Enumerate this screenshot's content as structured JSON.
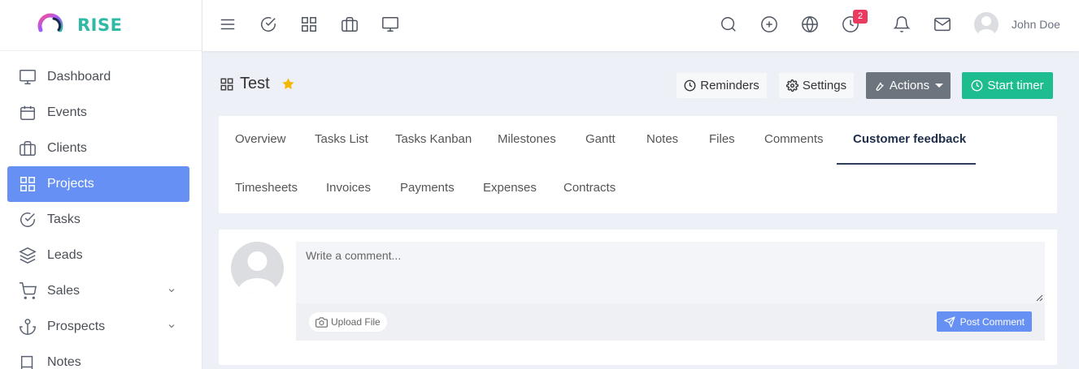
{
  "brand": {
    "name": "RISE",
    "logo": "rise-logo"
  },
  "sidebar": {
    "items": [
      {
        "label": "Dashboard",
        "icon": "monitor-icon"
      },
      {
        "label": "Events",
        "icon": "calendar-icon"
      },
      {
        "label": "Clients",
        "icon": "briefcase-icon"
      },
      {
        "label": "Projects",
        "icon": "grid-icon",
        "active": true
      },
      {
        "label": "Tasks",
        "icon": "check-circle-icon"
      },
      {
        "label": "Leads",
        "icon": "layers-icon"
      },
      {
        "label": "Sales",
        "icon": "cart-icon",
        "has_submenu": true
      },
      {
        "label": "Prospects",
        "icon": "anchor-icon",
        "has_submenu": true
      },
      {
        "label": "Notes",
        "icon": "book-icon"
      }
    ]
  },
  "topbar": {
    "left_icons": [
      "menu-icon",
      "check-circle-icon",
      "grid-icon",
      "briefcase-icon",
      "monitor-icon"
    ],
    "right_icons": [
      "search-icon",
      "plus-circle-icon",
      "globe-icon",
      "clock-icon",
      "bell-icon",
      "mail-icon"
    ],
    "timer_badge": "2",
    "user_name": "John Doe"
  },
  "page": {
    "title": "Test",
    "starred": true,
    "buttons": {
      "reminders": "Reminders",
      "settings": "Settings",
      "actions": "Actions",
      "start_timer": "Start timer"
    }
  },
  "tabs": [
    {
      "label": "Overview"
    },
    {
      "label": "Tasks List"
    },
    {
      "label": "Tasks Kanban"
    },
    {
      "label": "Milestones"
    },
    {
      "label": "Gantt"
    },
    {
      "label": "Notes"
    },
    {
      "label": "Files"
    },
    {
      "label": "Comments"
    },
    {
      "label": "Customer feedback",
      "active": true
    },
    {
      "label": "Timesheets"
    },
    {
      "label": "Invoices"
    },
    {
      "label": "Payments"
    },
    {
      "label": "Expenses"
    },
    {
      "label": "Contracts"
    }
  ],
  "comment": {
    "placeholder": "Write a comment...",
    "value": "",
    "upload_label": "Upload File",
    "post_label": "Post Comment"
  },
  "colors": {
    "accent": "#6690f4",
    "brand_teal": "#2fb9a6",
    "start_timer": "#1dbd90",
    "actions": "#6c757d",
    "badge": "#ea3a5f",
    "star": "#f5b800"
  }
}
